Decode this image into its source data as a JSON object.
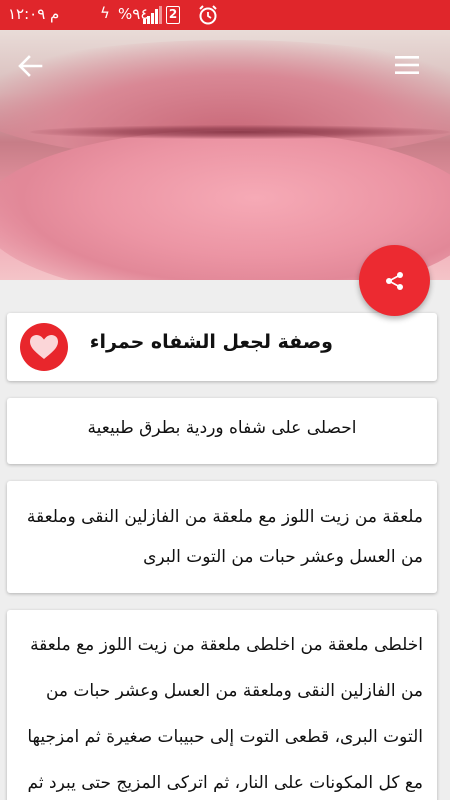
{
  "status_bar": {
    "clock": "م ١٢:٠٩",
    "battery": "%٩٤",
    "sim_number": "2",
    "icons": [
      "charging-icon",
      "signal-icon",
      "sim-icon",
      "alarm-icon"
    ],
    "background_color": "#e0262b"
  },
  "toolbar": {
    "back_icon": "arrow-back-icon",
    "menu_icon": "hamburger-menu-icon"
  },
  "fab": {
    "icon": "share-icon",
    "color": "#ec2a31"
  },
  "recipe": {
    "title": "وصفة لجعل الشفاه حمراء",
    "favorite_icon": "heart-icon",
    "subtitle": "احصلى على شفاه وردية بطرق طبيعية",
    "ingredients": "ملعقة من زيت اللوز مع ملعقة من الفازلين النقى وملعقة من العسل وعشر حبات من التوت البرى",
    "method": "اخلطى ملعقة من اخلطى ملعقة من زيت اللوز مع ملعقة من الفازلين النقى وملعقة من العسل وعشر حبات من التوت البرى، قطعى التوت إلى حبيبات صغيرة ثم امزجيها مع كل المكونات على النار، ثم اتركى المزيج حتى يبرد ثم"
  },
  "accent_color": "#e8262c"
}
